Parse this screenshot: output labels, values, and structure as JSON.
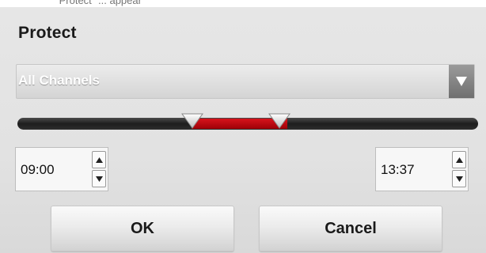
{
  "dialog": {
    "top_strip_text": "\"Protect\" ... appear",
    "title": "Protect",
    "channel_select": {
      "selected": "All Channels",
      "icon": "dropdown-arrow-icon"
    },
    "time_range_slider": {
      "range_color": "#c0050e",
      "track_color": "#1e1e1e"
    },
    "start_time": {
      "value": "09:00"
    },
    "end_time": {
      "value": "13:37"
    },
    "buttons": {
      "ok": "OK",
      "cancel": "Cancel"
    }
  }
}
